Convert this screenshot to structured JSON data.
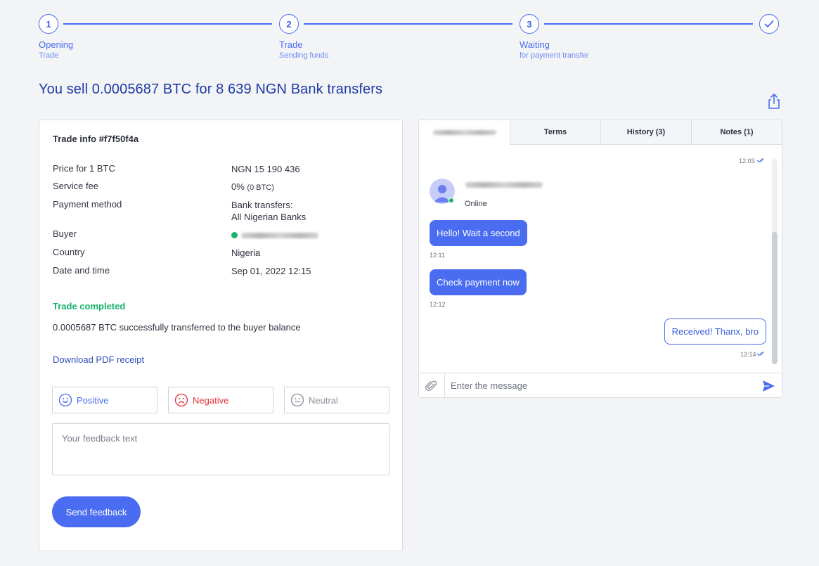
{
  "stepper": {
    "steps": [
      {
        "number": "1",
        "title": "Opening",
        "subtitle": "Trade"
      },
      {
        "number": "2",
        "title": "Trade",
        "subtitle": "Sending funds"
      },
      {
        "number": "3",
        "title": "Waiting",
        "subtitle": "for payment transfer"
      },
      {
        "icon": "check-icon"
      }
    ]
  },
  "page_title": "You sell 0.0005687 BTC for 8 639 NGN Bank transfers",
  "share_icon": "share-icon",
  "trade_info": {
    "title": "Trade info #f7f50f4a",
    "rows": {
      "price": {
        "label": "Price for 1 BTC",
        "value": "NGN 15 190 436"
      },
      "fee": {
        "label": "Service fee",
        "value": "0%",
        "value_small": "(0 BTC)"
      },
      "payment": {
        "label": "Payment method",
        "value_line1": "Bank transfers:",
        "value_line2": "All Nigerian Banks"
      },
      "buyer": {
        "label": "Buyer"
      },
      "country": {
        "label": "Country",
        "value": "Nigeria"
      },
      "datetime": {
        "label": "Date and time",
        "value": "Sep 01, 2022 12:15"
      }
    },
    "status": "Trade completed",
    "status_message": "0.0005687 BTC successfully transferred to the buyer balance",
    "download_link": "Download PDF receipt"
  },
  "feedback": {
    "positive": "Positive",
    "negative": "Negative",
    "neutral": "Neutral",
    "placeholder": "Your feedback text",
    "send_label": "Send feedback"
  },
  "chat": {
    "tabs": {
      "terms": "Terms",
      "history": "History (3)",
      "notes": "Notes (1)"
    },
    "online_status": "Online",
    "first_time": "12:03",
    "messages": [
      {
        "text": "Hello! Wait a second",
        "time": "12:11",
        "direction": "in"
      },
      {
        "text": "Check payment now",
        "time": "12:12",
        "direction": "in"
      },
      {
        "text": "Received! Thanx, bro",
        "time": "12:14",
        "direction": "out"
      }
    ],
    "input_placeholder": "Enter the message"
  },
  "colors": {
    "accent": "#4a6cf0",
    "success": "#17b26a",
    "danger": "#e0343a",
    "title": "#1e3aa8"
  }
}
